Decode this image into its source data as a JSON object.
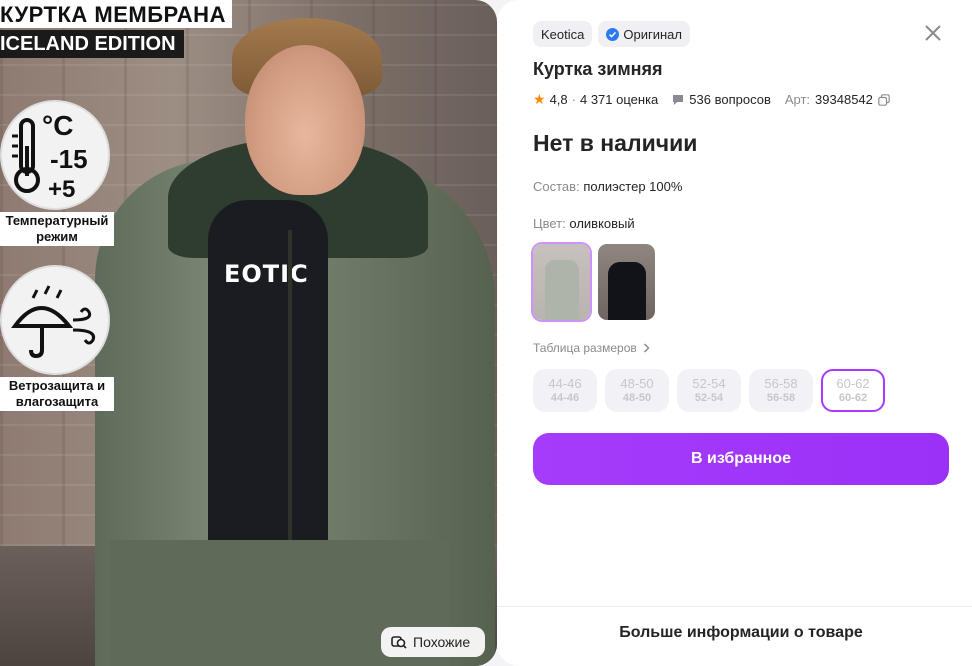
{
  "photo": {
    "promo_line1": "КУРТКА МЕМБРАНА",
    "promo_line2": "ICELAND EDITION",
    "temp_symbol": "°C",
    "temp_low": "-15",
    "temp_high": "+5",
    "temp_label": "Температурный режим",
    "protection_label": "Ветрозащита и влагозащита",
    "shirt_print": "EOTIC",
    "similar_label": "Похожие"
  },
  "product": {
    "brand": "Keotica",
    "original_label": "Оригинал",
    "title": "Куртка зимняя",
    "rating": "4,8",
    "reviews": "4 371 оценка",
    "questions": "536 вопросов",
    "article_label": "Арт:",
    "article": "39348542",
    "stock_status": "Нет в наличии",
    "composition_label": "Состав:",
    "composition": "полиэстер 100%",
    "color_label": "Цвет:",
    "color": "оливковый",
    "size_table_label": "Таблица размеров",
    "sizes": [
      {
        "label": "44-46",
        "sub": "44-46"
      },
      {
        "label": "48-50",
        "sub": "48-50"
      },
      {
        "label": "52-54",
        "sub": "52-54"
      },
      {
        "label": "56-58",
        "sub": "56-58"
      },
      {
        "label": "60-62",
        "sub": "60-62"
      }
    ],
    "selected_size": "60-62",
    "favorite_button": "В избранное",
    "more_info": "Больше информации о товаре"
  },
  "colors": {
    "accent": "#a73afd",
    "star": "#ff8a00",
    "verified": "#2b7bf0"
  }
}
